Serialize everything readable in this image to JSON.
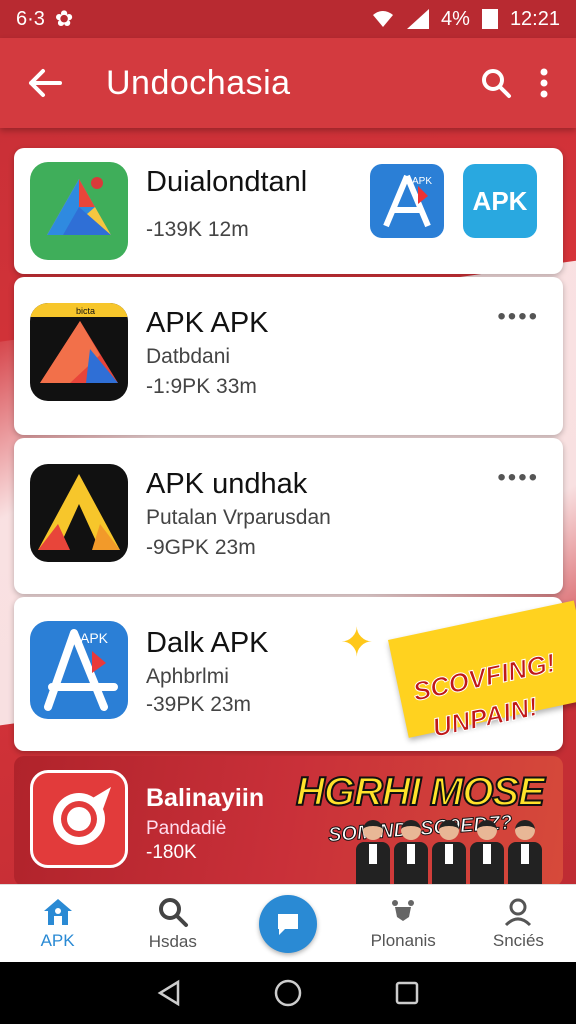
{
  "status_bar": {
    "left_text": "6·3",
    "battery_text": "4%",
    "time": "12:21"
  },
  "app_bar": {
    "title": "Undochasia"
  },
  "apps": [
    {
      "name": "Duialondtanl",
      "subtitle": "",
      "stats": "-139K  12m"
    },
    {
      "name": "APK APK",
      "subtitle": "Datbdani",
      "stats": "-1:9PK  33m",
      "icon_label": "bicta"
    },
    {
      "name": "APK undhak",
      "subtitle": "Putalan Vrparusdan",
      "stats": "-9GPK  23m"
    },
    {
      "name": "Dalk APK",
      "subtitle": "Aphbrlmi",
      "stats": "-39PK  23m",
      "icon_label": "APK"
    }
  ],
  "featured_minis": [
    {
      "label": "APK",
      "color": "#2b7fd6"
    },
    {
      "label": "APK",
      "color": "#29a8e0"
    }
  ],
  "promo": {
    "name": "Balinayiin",
    "subtitle": "Pandadiė",
    "stats": "-180K",
    "headline": "HGRHI MOSE",
    "tagline": "SOMIND· SO9EDZ?",
    "banner_line1": "SCOVFING!",
    "banner_line2": "UNPAIN!"
  },
  "more_dots": "••••",
  "bottom_nav": [
    {
      "label": "APK",
      "icon": "home-icon",
      "active": true
    },
    {
      "label": "Hsdas",
      "icon": "search-icon",
      "active": false
    },
    {
      "label": "",
      "icon": "chat-icon",
      "active": false
    },
    {
      "label": "Plonanis",
      "icon": "notification-icon",
      "active": false
    },
    {
      "label": "Snciés",
      "icon": "profile-icon",
      "active": false
    }
  ],
  "colors": {
    "primary": "#d33a3f",
    "accent": "#2a8ad4",
    "banner": "#ffd21f"
  }
}
